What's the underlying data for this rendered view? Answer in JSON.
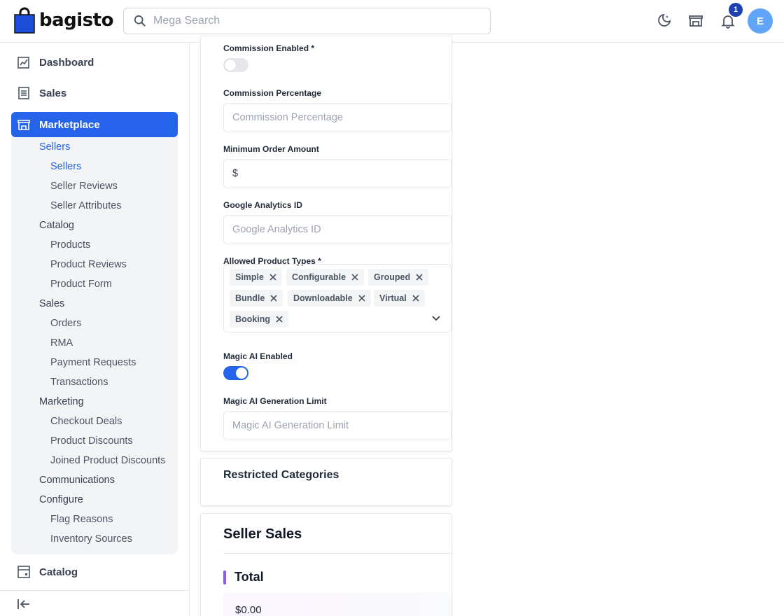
{
  "brand": {
    "name": "bagisto",
    "color": "#1d4ed8"
  },
  "header": {
    "search_placeholder": "Mega Search",
    "icons": [
      "dark-mode-icon",
      "storefront-icon",
      "bell-icon"
    ],
    "notification_count": "1",
    "avatar_letter": "E"
  },
  "sidebar": {
    "top": [
      {
        "label": "Dashboard",
        "icon": "dashboard-icon"
      },
      {
        "label": "Sales",
        "icon": "sales-icon"
      }
    ],
    "active": {
      "label": "Marketplace",
      "icon": "marketplace-icon",
      "color": "#2563eb"
    },
    "submenu": [
      {
        "label": "Sellers",
        "level": 1,
        "selected": true
      },
      {
        "label": "Sellers",
        "level": 2,
        "selected": true
      },
      {
        "label": "Seller Reviews",
        "level": 2
      },
      {
        "label": "Seller Attributes",
        "level": 2
      },
      {
        "label": "Catalog",
        "level": 1
      },
      {
        "label": "Products",
        "level": 2
      },
      {
        "label": "Product Reviews",
        "level": 2
      },
      {
        "label": "Product Form",
        "level": 2
      },
      {
        "label": "Sales",
        "level": 1
      },
      {
        "label": "Orders",
        "level": 2
      },
      {
        "label": "RMA",
        "level": 2
      },
      {
        "label": "Payment Requests",
        "level": 2
      },
      {
        "label": "Transactions",
        "level": 2
      },
      {
        "label": "Marketing",
        "level": 1
      },
      {
        "label": "Checkout Deals",
        "level": 2
      },
      {
        "label": "Product Discounts",
        "level": 2
      },
      {
        "label": "Joined Product Discounts",
        "level": 2
      },
      {
        "label": "Communications",
        "level": 1
      },
      {
        "label": "Configure",
        "level": 1
      },
      {
        "label": "Flag Reasons",
        "level": 2
      },
      {
        "label": "Inventory Sources",
        "level": 2
      }
    ],
    "after": {
      "label": "Catalog",
      "icon": "catalog-icon"
    }
  },
  "form": {
    "commission_enabled": {
      "label": "Commission Enabled *",
      "on": false
    },
    "commission_percentage": {
      "label": "Commission Percentage",
      "placeholder": "Commission Percentage",
      "value": ""
    },
    "minimum_order": {
      "label": "Minimum Order Amount",
      "value": "$"
    },
    "google_analytics": {
      "label": "Google Analytics ID",
      "placeholder": "Google Analytics ID"
    },
    "allowed_types": {
      "label": "Allowed Product Types *",
      "tags": [
        "Simple",
        "Configurable",
        "Grouped",
        "Bundle",
        "Downloadable",
        "Virtual",
        "Booking"
      ]
    },
    "magic_ai_enabled": {
      "label": "Magic AI Enabled",
      "on": true
    },
    "magic_ai_limit": {
      "label": "Magic AI Generation Limit",
      "placeholder": "Magic AI Generation Limit"
    }
  },
  "restricted": {
    "title": "Restricted Categories"
  },
  "seller_sales": {
    "title": "Seller Sales",
    "total_label": "Total",
    "total_value": "$0.00"
  }
}
